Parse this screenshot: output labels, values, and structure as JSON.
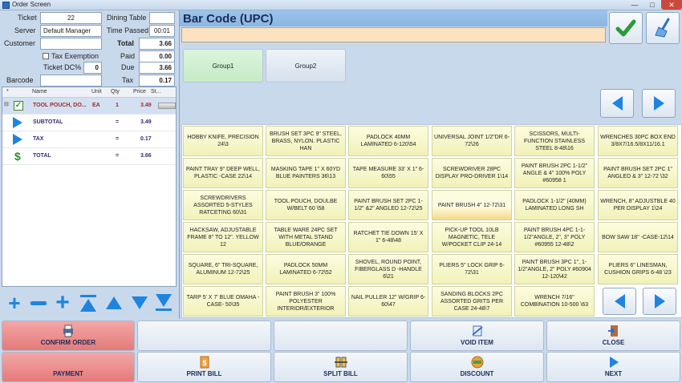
{
  "window": {
    "title": "Order Screen"
  },
  "info": {
    "ticket_label": "Ticket",
    "ticket_value": "22",
    "server_label": "Server",
    "server_value": "Default Manager",
    "customer_label": "Customer",
    "customer_value": "",
    "dining_table_label": "Dining Table",
    "dining_table_value": "",
    "time_passed_label": "Time Passed",
    "time_passed_value": "00:01",
    "total_label": "Total",
    "total_value": "3.66",
    "tax_exemption_label": "Tax Exemption",
    "paid_label": "Paid",
    "paid_value": "0.00",
    "ticket_dc_label": "Ticket DC%",
    "ticket_dc_value": "0",
    "due_label": "Due",
    "due_value": "3.66",
    "barcode_label": "Barcode",
    "barcode_value": "",
    "tax_label": "Tax",
    "tax_value": "0.17"
  },
  "order": {
    "columns": {
      "mark": "*",
      "name": "Name",
      "unit": "Unit",
      "qty": "Qty",
      "price": "Price",
      "status": "St..."
    },
    "rows": [
      {
        "name": "TOOL POUCH, DO...",
        "unit": "EA",
        "qty": "1",
        "price": "3.49",
        "kind": "item"
      },
      {
        "name": "SUBTOTAL",
        "unit": "",
        "qty": "=",
        "price": "3.49",
        "kind": "subtotal"
      },
      {
        "name": "TAX",
        "unit": "",
        "qty": "=",
        "price": "0.17",
        "kind": "tax"
      },
      {
        "name": "TOTAL",
        "unit": "",
        "qty": "=",
        "price": "3.66",
        "kind": "total"
      }
    ]
  },
  "tool_icons": [
    "plus-icon",
    "minus-icon",
    "plus-bold-icon",
    "arrow-top-icon",
    "arrow-up-icon",
    "arrow-down-icon",
    "arrow-bottom-icon"
  ],
  "barcode": {
    "title": "Bar Code (UPC)",
    "value": ""
  },
  "groups": [
    "Group1",
    "Group2"
  ],
  "items": [
    [
      "HOBBY KNIFE, PRECISION 24\\3",
      "BRUSH SET 3PC 9\" STEEL, BRASS, NYLON. PLASTIC HAN",
      "PADLOCK 40MM LAMINATED 6-120\\54",
      "UNIVERSAL JOINT 1/2\"DR 6-72\\26",
      "SCISSORS, MULTI-FUNCTION STAINLESS STEEL 8-48\\16",
      "WRENCHES 30PC BOX END 3/8X7/16.5/8X11/16.1"
    ],
    [
      "PAINT TRAY 9\" DEEP WELL, PLASTIC -CASE 22\\14",
      "MASKING TAPE 1\" X 60YD BLUE PAINTERS 36\\13",
      "TAPE MEASURE 33' X 1\" 6-60\\55",
      "SCREWDRIVER 28PC DISPLAY PRO-DRIVER 1\\14",
      "PAINT BRUSH 2PC 1-1/2\" ANGLE & 4\" 100% POLY #60958 1",
      "PAINT BRUSH SET 2PC 1\" ANGLED & 3\" 12-72 \\32"
    ],
    [
      "SCREWDRIVERS ASSORTED 5-STYLES RATCETING 60\\31",
      "TOOL POUCH, DOULBE W/BELT 60 \\58",
      "PAINT BRUSH SET 2PC 1-1/2\" &2\" ANGLED 12-72\\25",
      "PAINT BRUSH 4\" 12-72\\31",
      "PADLOCK 1-1/2\" (40MM) LAMINATED LONG SH",
      "WRENCH, 8\" ADJUSTBLE 40 PER DISPLAY 1\\24"
    ],
    [
      "HACKSAW, ADJUSTABLE FRAME 8\" TO 12\". YELLOW 12",
      "TABLE WARE 24PC SET WITH METAL STAND BLUE/ORANGE",
      "RATCHET TIE DOWN 15' X 1\" 6-48\\48",
      "PICK-UP TOOL 10LB MAGNETIC, TELE W/POCKET CLIP 24-14",
      "PAINT BRUSH 4PC 1-1-1/2\"ANGLE, 2\", 3\" POLY #60955 12-48\\2",
      "BOW SAW 18\" -CASE-12\\14"
    ],
    [
      "SQUARE, 6\" TRI-SQUARE, ALUMINUM 12-72\\25",
      "PADLOCK 50MM LAMINATED 6-72\\52",
      "SHOVEL, ROUND POINT, FIBERGLASS D -HANDLE 6\\21",
      "PLIERS 5\" LOCK GRIP 6-72\\31",
      "PAINT BRUSH 3PC 1\", 1-1/2\"ANGLE, 2\" POLY #60904 12-120\\42",
      "PLIERS 6\" LINESMAN, CUSHION GRIPS 6-48 \\23"
    ],
    [
      "TARP 5' X 7' BLUE OMAHA -CASE- 50\\35",
      "PAINT BRUSH 3\" 100% POLYESTER INTERIOR/EXTERIOR",
      "NAIL PULLER 12\" W/GRIP 6-60\\47",
      "SANDING BLOCKS 2PC ASSORTED GRITS PER CASE 24-48\\7",
      "WRENCH 7/16\" COMBINATION 10-500 \\63"
    ]
  ],
  "actions": {
    "confirm_order": "CONFIRM ORDER",
    "void_item": "VOID ITEM",
    "close": "CLOSE",
    "payment": "PAYMENT",
    "print_bill": "PRINT BILL",
    "split_bill": "SPLIT BILL",
    "discount": "DISCOUNT",
    "next": "NEXT"
  },
  "colors": {
    "accent_blue": "#1f84e0",
    "action_red": "#e57a7a",
    "item_yellow": "#f1f2b8",
    "barcode_bg": "#fbe3c2",
    "group_green": "#c4ebc6"
  }
}
